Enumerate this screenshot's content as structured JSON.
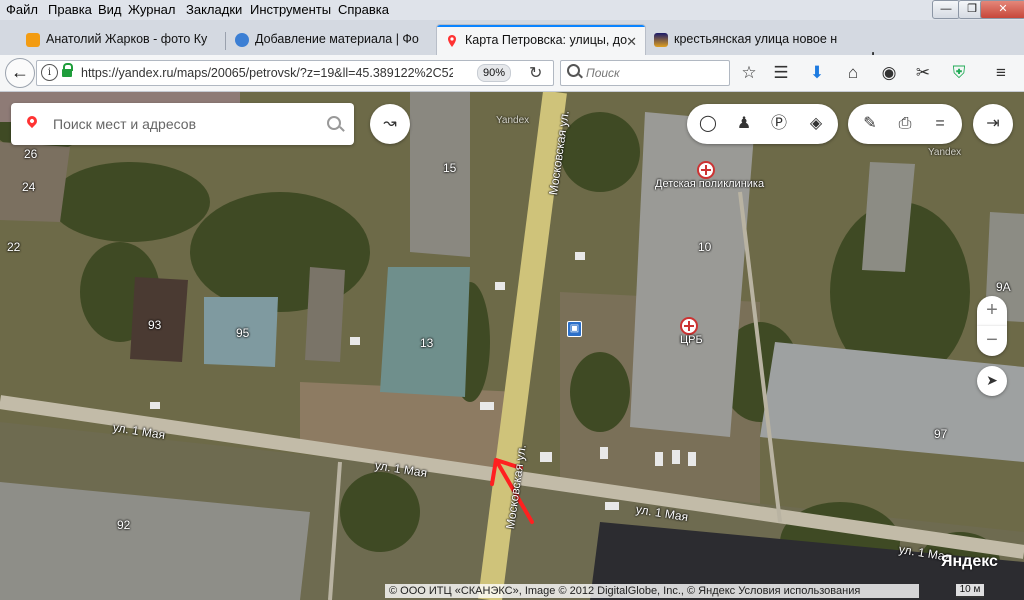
{
  "menu": [
    "Файл",
    "Правка",
    "Вид",
    "Журнал",
    "Закладки",
    "Инструменты",
    "Справка"
  ],
  "tabs": [
    {
      "label": "Анатолий Жарков - фото Ку",
      "icon_color": "#f39c12"
    },
    {
      "label": "Добавление материала | Фо",
      "icon_color": "#3c7fd4"
    },
    {
      "label": "Карта Петровска: улицы, до",
      "icon_color": "#ff3333"
    },
    {
      "label": "крестьянская улица новое н",
      "icon_color": "#e0a020"
    }
  ],
  "nav": {
    "url": "https://yandex.ru/maps/20065/petrovsk/?z=19&ll=45.389122%2C52.30",
    "zoom": "90%",
    "search_placeholder": "Поиск"
  },
  "map": {
    "search_placeholder": "Поиск мест и адресов",
    "house_numbers": [
      "26",
      "24",
      "22",
      "93",
      "95",
      "15",
      "13",
      "10",
      "9А",
      "97",
      "92"
    ],
    "streets": [
      "Московская ул.",
      "ул. 1 Мая",
      "ул. 1 Мая",
      "Московская ул.",
      "ул. 1 Мая",
      "ул. 1 Мая"
    ],
    "pois": [
      "Детская поликлиника",
      "ЦРБ"
    ],
    "watermarks": [
      "Yandex",
      "Yandex"
    ],
    "copyright": "© ООО ИТЦ «СКАНЭКС», Image © 2012 DigitalGlobe, Inc., © Яндекс Условия использования",
    "scale": "10 м",
    "logo": "Яндекс"
  }
}
